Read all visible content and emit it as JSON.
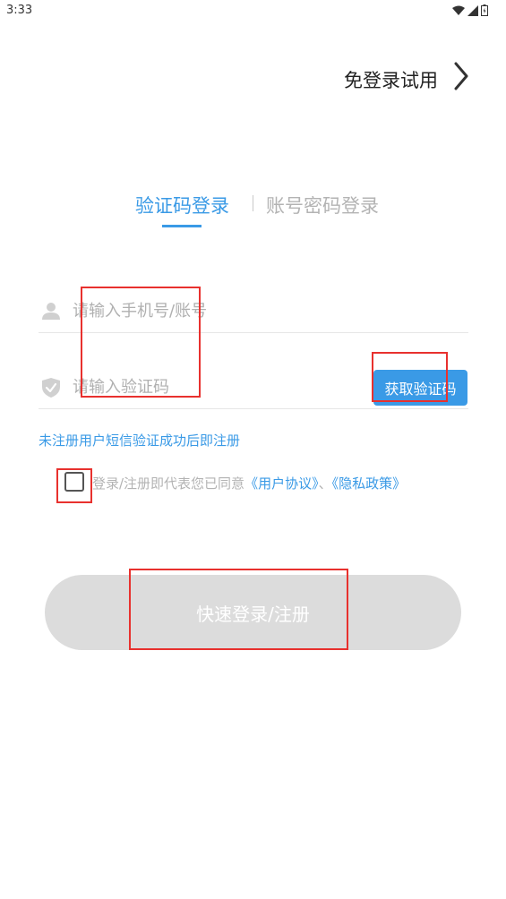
{
  "status_bar": {
    "time": "3:33"
  },
  "header": {
    "skip_label": "免登录试用"
  },
  "tabs": [
    {
      "label": "验证码登录",
      "active": true
    },
    {
      "label": "账号密码登录",
      "active": false
    }
  ],
  "form": {
    "phone_placeholder": "请输入手机号/账号",
    "code_placeholder": "请输入验证码",
    "get_code_label": "获取验证码",
    "register_hint": "未注册用户短信验证成功后即注册"
  },
  "agreement": {
    "prefix": "登录/注册即代表您已同意",
    "user_agreement": "《用户协议》",
    "separator": "、",
    "privacy_policy": "《隐私政策》",
    "checked": false
  },
  "submit_label": "快速登录/注册",
  "colors": {
    "accent": "#3a9ae6",
    "annotation": "#e8312e",
    "submit_disabled": "#dcdcdc",
    "muted_text": "#b3b3b3"
  }
}
